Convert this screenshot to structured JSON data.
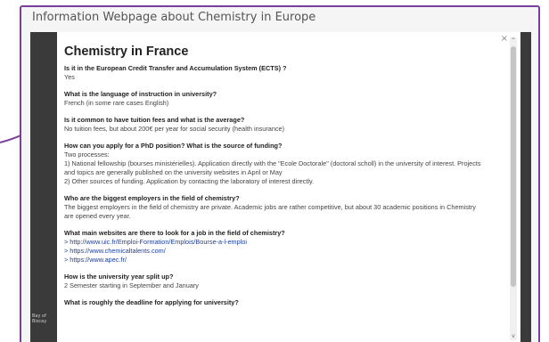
{
  "window": {
    "title": "Information Webpage about Chemistry in Europe"
  },
  "overlay": {
    "side_text_1": "Bay of",
    "side_text_2": "Biscay"
  },
  "modal": {
    "close_glyph": "×",
    "heading": "Chemistry in France",
    "qa": [
      {
        "q": "Is it in the European Credit Transfer and Accumulation System (ECTS) ?",
        "a": [
          "Yes"
        ]
      },
      {
        "q": "What is the language of instruction in university?",
        "a": [
          "French (in some rare cases English)"
        ]
      },
      {
        "q": "Is it common to have tuition fees and what is the average?",
        "a": [
          "No tuition fees, but about 200€ per year for social security (health insurance)"
        ]
      },
      {
        "q": "How can you apply for a PhD position? What is the source of funding?",
        "a": [
          "Two processes:",
          "1) National fellowship (bourses ministérielles). Application directly with the \"Ecole Doctorale\" (doctoral scholl) in the university of interest. Projects",
          "and topics are generally published on the university websites in April or May",
          "2) Other sources of funding. Application by contacting the laboratory of interest directly."
        ]
      },
      {
        "q": "Who are the biggest employers in the field of chemistry?",
        "a": [
          "The biggest employers in the field of chemistry are private. Academic jobs are rather competitive, but about 30 academic positions in Chemistry",
          "are opened every year."
        ]
      },
      {
        "q": "What main websites are there to look for a job in the field of chemistry?",
        "links": [
          "> http://www.uic.fr/Emploi-Formation/Emplois/Bourse-a-l-emploi",
          "> https://www.chemicaltalents.com/",
          "> https://www.apec.fr/"
        ]
      },
      {
        "q": "How is the university year split up?",
        "a": [
          "2 Semester starting in September and January"
        ]
      },
      {
        "q": "What is roughly the deadline for applying for university?",
        "a": []
      }
    ]
  },
  "scrollbar": {
    "up_glyph": "^",
    "down_glyph": "v",
    "position_fraction": 0.0
  },
  "colors": {
    "frame_border": "#7a3f9a",
    "overlay": "#3a3a3a",
    "link": "#1f3f9a"
  }
}
